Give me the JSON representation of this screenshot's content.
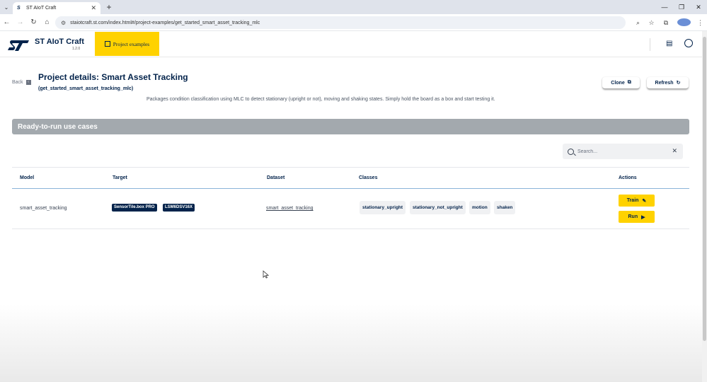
{
  "browser": {
    "tab_title": "ST AIoT Craft",
    "tab_favicon": "st-logo-icon",
    "url": "staiotcraft.st.com/index.html#/project-examples/get_started_smart_asset_tracking_mlc"
  },
  "header": {
    "app_name": "ST AIoT Craft",
    "version": "1.2.0",
    "nav_button": "Project examples",
    "brand_color": "#03234b",
    "accent_color": "#ffd200"
  },
  "page": {
    "back_label": "Back",
    "title": "Project details: Smart Asset Tracking",
    "subtitle": "(get_started_smart_asset_tracking_mlc)",
    "description": "Packages condition classification using MLC to detect stationary (upright or not), moving and shaking states. Simply hold the board as a box and start testing it.",
    "clone_label": "Clone",
    "refresh_label": "Refresh"
  },
  "section": {
    "title": "Ready-to-run use cases"
  },
  "search": {
    "placeholder": "Search..."
  },
  "table": {
    "headers": {
      "model": "Model",
      "target": "Target",
      "dataset": "Dataset",
      "classes": "Classes",
      "actions": "Actions"
    },
    "rows": [
      {
        "model": "smart_asset_tracking",
        "targets": [
          "SensorTile.box PRO",
          "LSM6DSV16X"
        ],
        "dataset": "smart_asset_tracking",
        "classes": [
          "stationary_upright",
          "stationary_not_upright",
          "motion",
          "shaken"
        ],
        "actions": {
          "train": "Train",
          "run": "Run"
        }
      }
    ]
  }
}
